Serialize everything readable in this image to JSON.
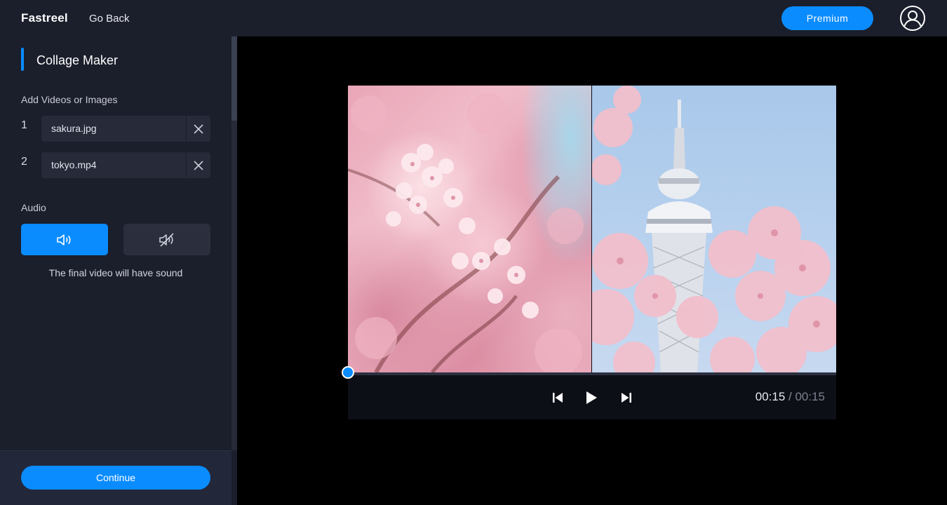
{
  "header": {
    "logo": "Fastreel",
    "go_back": "Go Back",
    "premium": "Premium",
    "account_icon": "user-circle-icon"
  },
  "sidebar": {
    "title": "Collage Maker",
    "add_label": "Add Videos or Images",
    "files": [
      {
        "index": "1",
        "name": "sakura.jpg",
        "remove_icon": "close-icon"
      },
      {
        "index": "2",
        "name": "tokyo.mp4",
        "remove_icon": "close-icon"
      }
    ],
    "audio_label": "Audio",
    "audio_options": [
      {
        "name": "sound-on",
        "icon": "speaker-icon",
        "selected": true
      },
      {
        "name": "sound-off",
        "icon": "speaker-muted-icon",
        "selected": false
      }
    ],
    "audio_note": "The final video will have sound",
    "continue": "Continue"
  },
  "player": {
    "time_current": "00:15",
    "time_separator": " / ",
    "time_total": "00:15",
    "playback_progress": 0,
    "controls": [
      "skip-back-icon",
      "play-icon",
      "skip-forward-icon"
    ]
  },
  "colors": {
    "accent": "#0a8cff",
    "header_bg": "#1b1e2b",
    "sidebar_bg": "#1b1e2b",
    "field_bg": "#262a39"
  }
}
